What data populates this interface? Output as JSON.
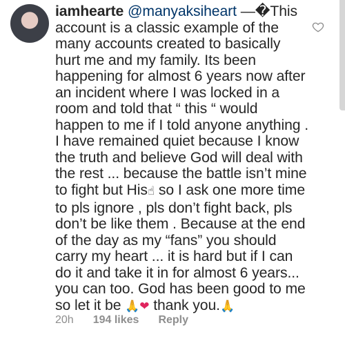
{
  "comment": {
    "username": "iamhearte",
    "mention": "@manyaksiheart",
    "text_1": "—�This account is a classic example of the many accounts created to basically hurt me and my family. Its been happening for almost 6 years now after an incident where I was locked in a room and told that “ this “ would happen to me if I told anyone anything . I have remained quiet because I know the truth and believe God will deal with the rest ... because the battle isn’t mine to fight but His",
    "emoji_1": "☝",
    "text_2": " so I ask one more time to pls ignore , pls don’t fight back, pls don’t be like them . Because at the end of the day as my “fans” you should carry my heart ... it is hard but if I can do it and take it in for almost 6 years... you can too. God has been good to me so let it be ",
    "emoji_2": "🙏",
    "emoji_3": "❤",
    "text_3": " thank you.",
    "emoji_4": "🙏"
  },
  "meta": {
    "time": "20h",
    "likes": "194 likes",
    "reply": "Reply"
  },
  "icons": {
    "like": "heart-outline-icon"
  }
}
